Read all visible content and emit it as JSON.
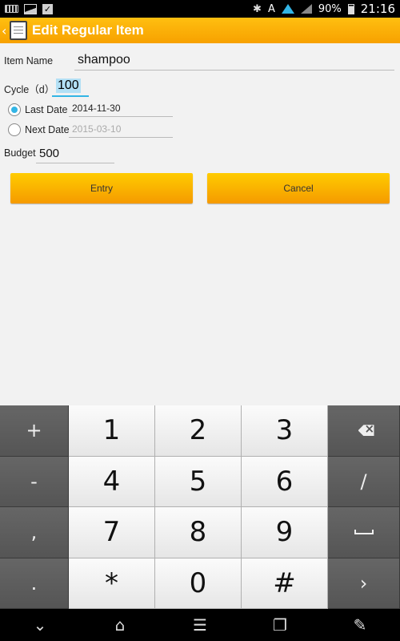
{
  "status_bar": {
    "carrier_letter": "A",
    "battery_percent": "90%",
    "time": "21:16"
  },
  "action_bar": {
    "title": "Edit Regular Item"
  },
  "form": {
    "item_name_label": "Item Name",
    "item_name_value": "shampoo",
    "cycle_label": "Cycle（d）",
    "cycle_value": "100",
    "last_date_label": "Last Date",
    "last_date_value": "2014-11-30",
    "last_date_selected": true,
    "next_date_label": "Next Date",
    "next_date_placeholder": "2015-03-10",
    "budget_label": "Budget",
    "budget_value": "500",
    "entry_button": "Entry",
    "cancel_button": "Cancel"
  },
  "keyboard": {
    "rows": [
      [
        "+",
        "1",
        "2",
        "3",
        "delete"
      ],
      [
        "-",
        "4",
        "5",
        "6",
        "/"
      ],
      [
        ",",
        "7",
        "8",
        "9",
        "space"
      ],
      [
        ".",
        "*",
        "0",
        "#",
        "›"
      ]
    ]
  },
  "navigation_bar": {
    "buttons": [
      "hide-keyboard",
      "home",
      "menu",
      "recent-apps",
      "edit"
    ]
  },
  "colors": {
    "accent": "#33b5e5",
    "action_bar": "#f7a100",
    "button": "#ffb400"
  }
}
